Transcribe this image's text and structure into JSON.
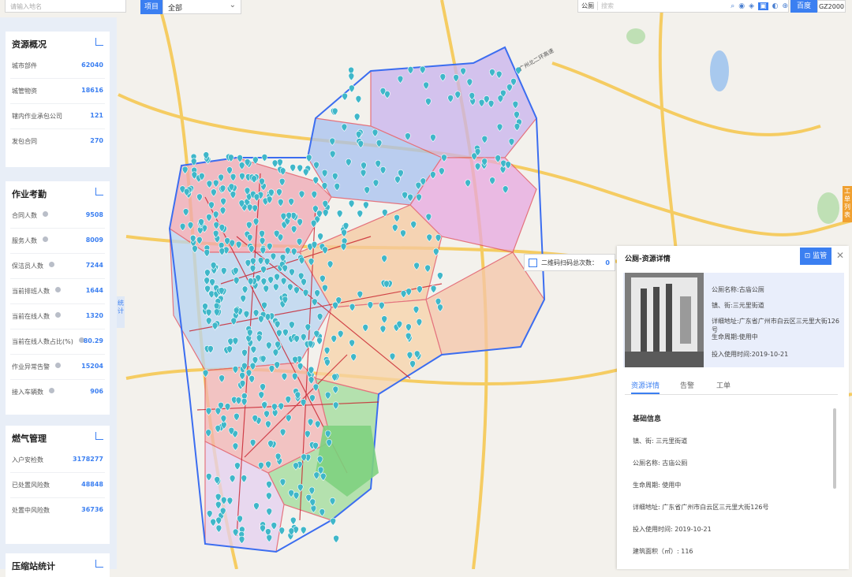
{
  "search": {
    "placeholder": "请输入地名"
  },
  "project": {
    "label": "项目",
    "selected": "全部"
  },
  "map_tools": {
    "layer_select": "公厕",
    "search_placeholder": "搜索",
    "baidu_label": "百度",
    "coord_label": "GZ2000"
  },
  "map_labels": {
    "ring_road": "广州北二环高速"
  },
  "stat_tab": "统计",
  "work_tab": "工单列表",
  "panels": [
    {
      "title": "资源概况",
      "rows": [
        {
          "label": "城市部件",
          "value": "62040",
          "info": false
        },
        {
          "label": "城管物资",
          "value": "18616",
          "info": false
        },
        {
          "label": "辖内作业承包公司",
          "value": "121",
          "info": false
        },
        {
          "label": "发包合同",
          "value": "270",
          "info": false
        }
      ]
    },
    {
      "title": "作业考勤",
      "rows": [
        {
          "label": "合同人数",
          "value": "9508",
          "info": true
        },
        {
          "label": "服务人数",
          "value": "8009",
          "info": true
        },
        {
          "label": "保洁员人数",
          "value": "7244",
          "info": true
        },
        {
          "label": "当前排班人数",
          "value": "1644",
          "info": true
        },
        {
          "label": "当前在线人数",
          "value": "1320",
          "info": true
        },
        {
          "label": "当前在线人数占比(%)",
          "value": "80.29",
          "info": true
        },
        {
          "label": "作业异常告警",
          "value": "15204",
          "info": true
        },
        {
          "label": "接入车辆数",
          "value": "906",
          "info": true
        }
      ]
    },
    {
      "title": "燃气管理",
      "rows": [
        {
          "label": "入户安检数",
          "value": "3178277",
          "info": false
        },
        {
          "label": "已处置风险数",
          "value": "48848",
          "info": false
        },
        {
          "label": "处置中风险数",
          "value": "36736",
          "info": false
        }
      ]
    },
    {
      "title": "压缩站统计",
      "rows": []
    }
  ],
  "scan_popup": {
    "label": "二维码扫码总次数：",
    "count": "0"
  },
  "detail": {
    "title": "公厕-资源详情",
    "supervise": "监管",
    "summary": [
      "公厕名称:古庙公厕",
      "镇、街:三元里街道",
      "详细地址:广东省广州市白云区三元里大街126号",
      "生命周期:使用中",
      "投入使用时间:2019-10-21"
    ],
    "tabs": [
      "资源详情",
      "告警",
      "工单"
    ],
    "section": "基础信息",
    "fields": [
      "镇、街: 三元里街道",
      "公厕名称: 古庙公厕",
      "生命周期: 使用中",
      "详细地址: 广东省广州市白云区三元里大街126号",
      "投入使用时间: 2019-10-21",
      "建筑面积（㎡）: 116"
    ]
  },
  "colors": {
    "accent": "#3b7ff1",
    "marker": "#3fb7c9",
    "boundary": "#3b6df0",
    "road": "#c81e2a"
  }
}
